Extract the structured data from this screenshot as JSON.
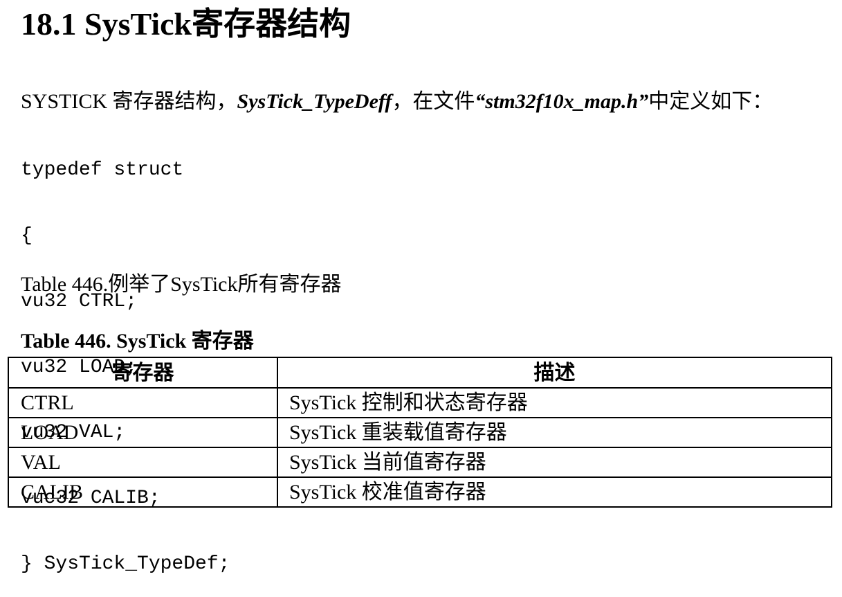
{
  "heading": "18.1 SysTick寄存器结构",
  "intro": {
    "prefix": "SYSTICK 寄存器结构，",
    "struct_name": "SysTick_TypeDeff",
    "middle": "，在文件",
    "file_name": "“stm32f10x_map.h”",
    "suffix": "中定义如下："
  },
  "code_lines": [
    "typedef struct",
    "{",
    "vu32 CTRL;",
    "vu32 LOAD;",
    "vu32 VAL;",
    "vuc32 CALIB;",
    "} SysTick_TypeDef;"
  ],
  "table_reference": "Table 446.例举了SysTick所有寄存器",
  "table_caption": "Table 446. SysTick 寄存器",
  "table": {
    "headers": [
      "寄存器",
      "描述"
    ],
    "rows": [
      [
        "CTRL",
        "SysTick 控制和状态寄存器"
      ],
      [
        "LOAD",
        "SysTick 重装载值寄存器"
      ],
      [
        "VAL",
        "SysTick 当前值寄存器"
      ],
      [
        "CALIB",
        "SysTick 校准值寄存器"
      ]
    ]
  }
}
